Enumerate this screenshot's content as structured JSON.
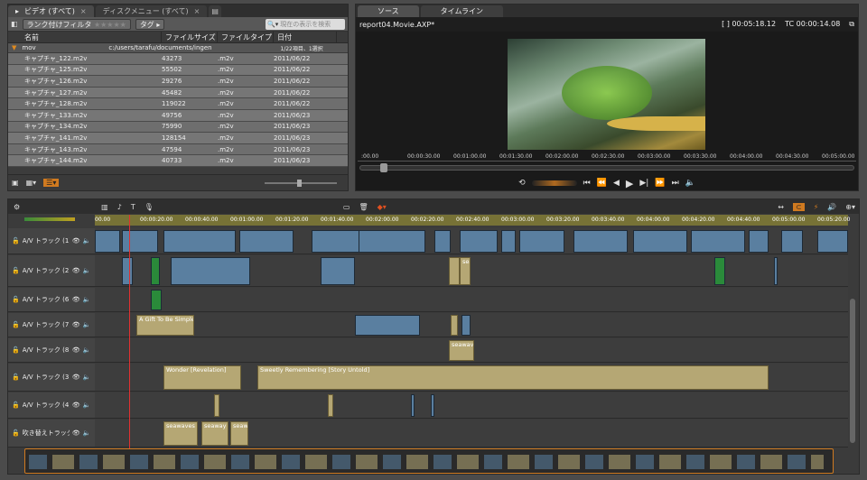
{
  "library": {
    "tabs": [
      {
        "label": "ビデオ (すべて)",
        "close": "×"
      },
      {
        "label": "ディスクメニュー (すべて)",
        "close": "×"
      }
    ],
    "rating_filter_label": "ランク付けフィルタ",
    "stars": "★★★★★",
    "tag_label": "タグ",
    "search_placeholder": "現在の表示を検索",
    "columns": [
      "名前",
      "ファイルサイズ",
      "ファイルタイプ",
      "日付"
    ],
    "folder": {
      "name": "mov",
      "path": "c:/users/tarafu/documents/ingen",
      "selection": "1/22項目、1選択"
    },
    "rows": [
      {
        "name": "キャプチャ_122.m2v",
        "size": "43273",
        "type": ".m2v",
        "date": "2011/06/22"
      },
      {
        "name": "キャプチャ_125.m2v",
        "size": "55502",
        "type": ".m2v",
        "date": "2011/06/22"
      },
      {
        "name": "キャプチャ_126.m2v",
        "size": "29276",
        "type": ".m2v",
        "date": "2011/06/22"
      },
      {
        "name": "キャプチャ_127.m2v",
        "size": "45482",
        "type": ".m2v",
        "date": "2011/06/22"
      },
      {
        "name": "キャプチャ_128.m2v",
        "size": "119022",
        "type": ".m2v",
        "date": "2011/06/22"
      },
      {
        "name": "キャプチャ_133.m2v",
        "size": "49756",
        "type": ".m2v",
        "date": "2011/06/23"
      },
      {
        "name": "キャプチャ_134.m2v",
        "size": "75990",
        "type": ".m2v",
        "date": "2011/06/23"
      },
      {
        "name": "キャプチャ_141.m2v",
        "size": "128154",
        "type": ".m2v",
        "date": "2011/06/23"
      },
      {
        "name": "キャプチャ_143.m2v",
        "size": "47594",
        "type": ".m2v",
        "date": "2011/06/23"
      },
      {
        "name": "キャプチャ_144.m2v",
        "size": "40733",
        "type": ".m2v",
        "date": "2011/06/23"
      }
    ]
  },
  "player": {
    "tabs": [
      "ソース",
      "タイムライン"
    ],
    "project_name": "report04.Movie.AXP*",
    "duration": "[ ] 00:05:18.12",
    "timecode": "TC 00:00:14.08",
    "ruler": [
      ":00.00",
      "00:00:30.00",
      "00:01:00.00",
      "00:01:30.00",
      "00:02:00.00",
      "00:02:30.00",
      "00:03:00.00",
      "00:03:30.00",
      "00:04:00.00",
      "00:04:30.00",
      "00:05:00.00"
    ]
  },
  "timeline": {
    "ruler": [
      "00.00",
      "00:00:20.00",
      "00:00:40.00",
      "00:01:00.00",
      "00:01:20.00",
      "00:01:40.00",
      "00:02:00.00",
      "00:02:20.00",
      "00:02:40.00",
      "00:03:00.00",
      "00:03:20.00",
      "00:03:40.00",
      "00:04:00.00",
      "00:04:20.00",
      "00:04:40.00",
      "00:05:00.00",
      "00:05:20.00"
    ],
    "tracks": [
      {
        "label": "A/V トラック (1)"
      },
      {
        "label": "A/V トラック (2)"
      },
      {
        "label": "A/V トラック (6)"
      },
      {
        "label": "A/V トラック (7)"
      },
      {
        "label": "A/V トラック (8)"
      },
      {
        "label": "A/V トラック (3)"
      },
      {
        "label": "A/V トラック (4)"
      },
      {
        "label": "吹き替えトラック"
      }
    ],
    "clip_labels": {
      "gift": "A Gift To Be Simple [M",
      "wonder": "Wonder [Revelation]",
      "sweetly": "Sweetly Remembering [Story Untold]",
      "seawaves": "seawaves",
      "seawaves_b": "seawaves w",
      "seawaves_c": "seaway",
      "seawaves_d": "seaw"
    }
  }
}
